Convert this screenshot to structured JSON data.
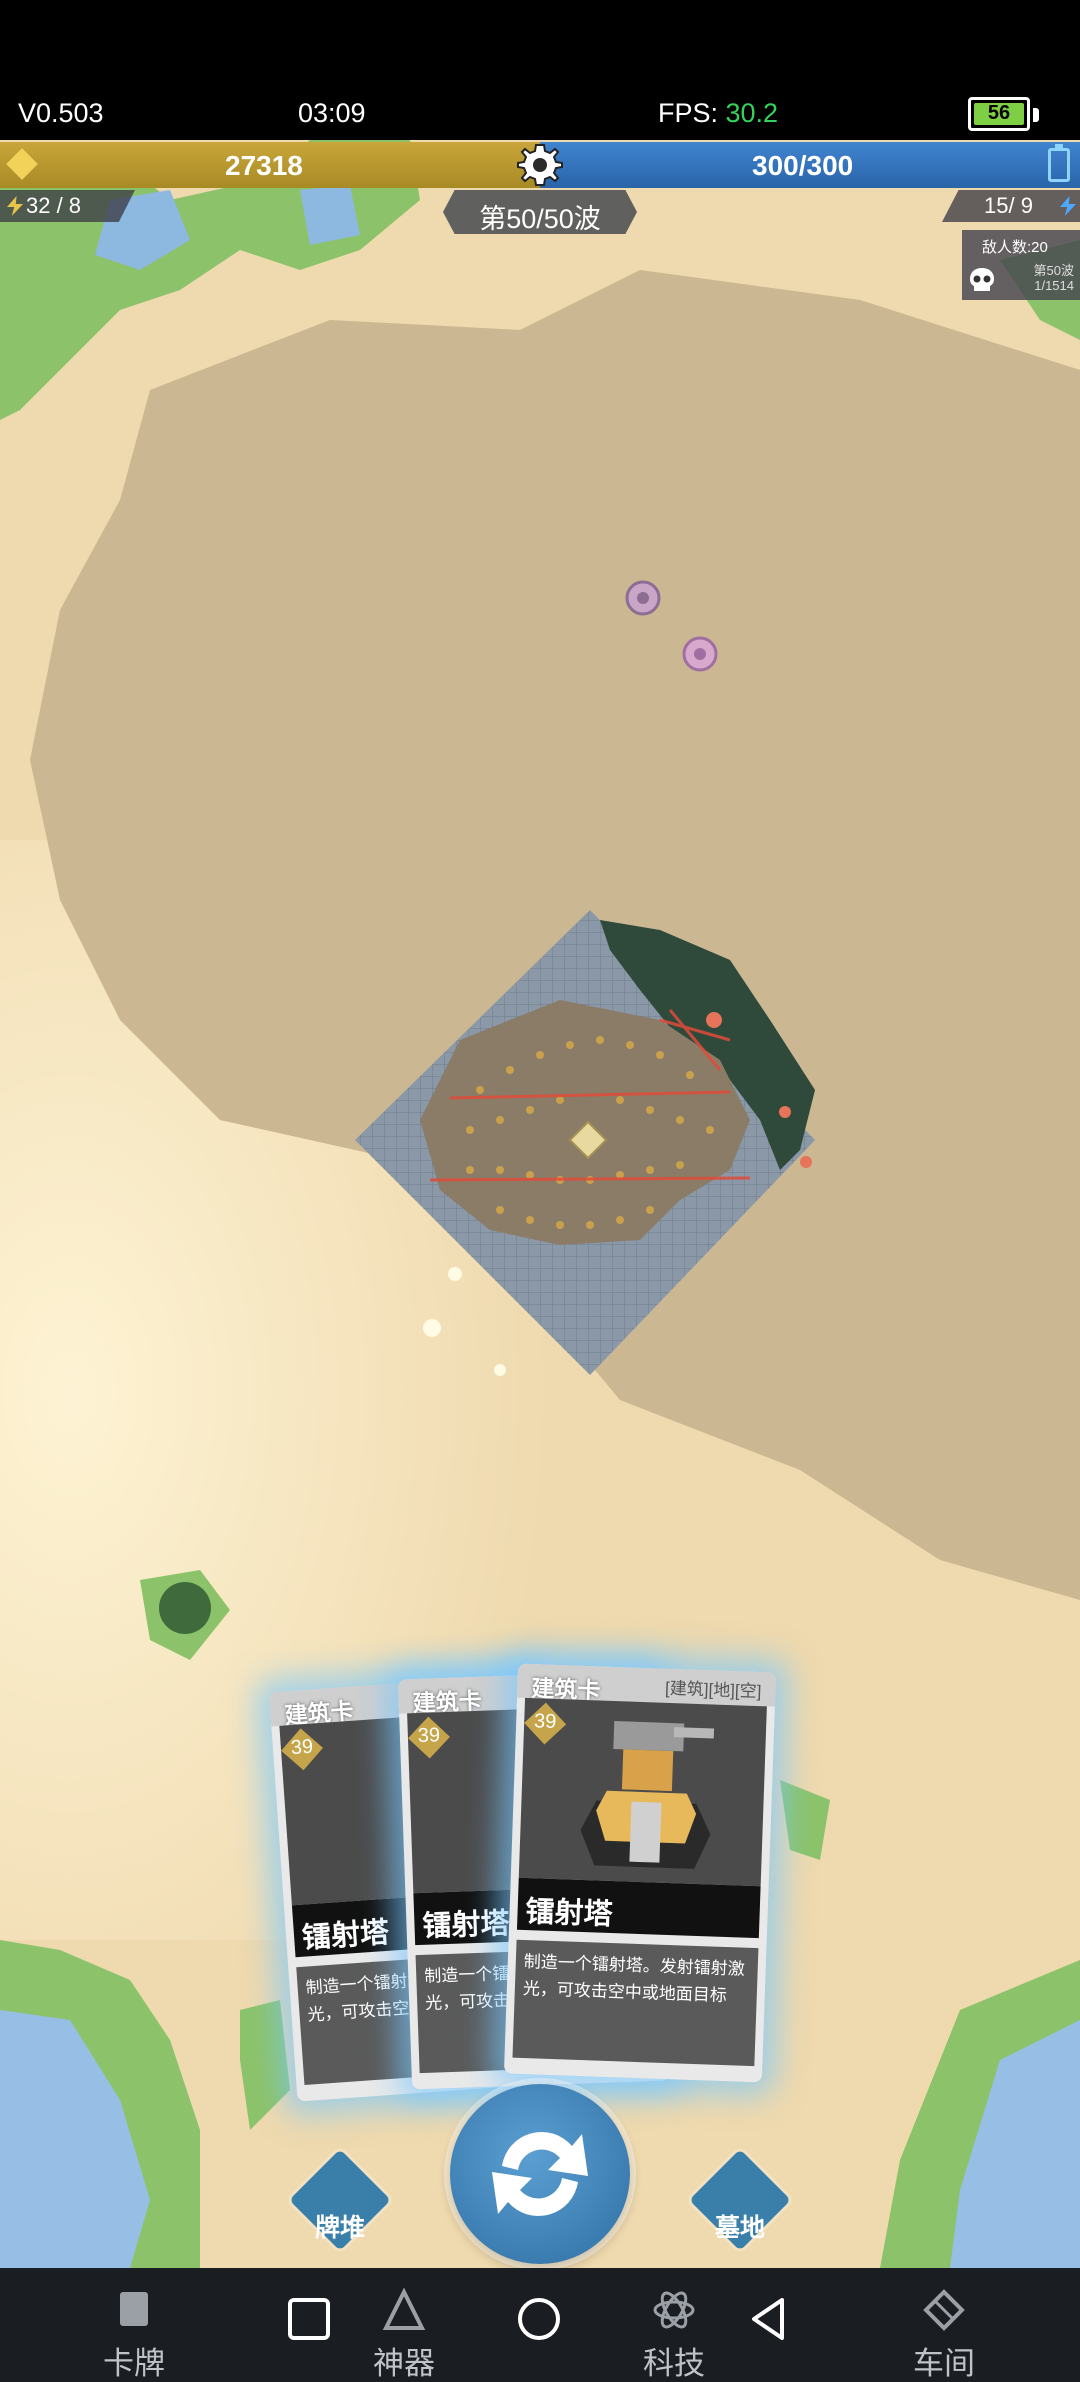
{
  "status_bar": {
    "version": "V0.503",
    "time": "03:09",
    "fps_label": "FPS: ",
    "fps_value": "30.2",
    "battery": "56"
  },
  "hud": {
    "gold": "27318",
    "energy": "300/300",
    "capacity_left": "32 / 8",
    "capacity_right": "15/  9",
    "wave": "第50/50波",
    "enemy_count": "敌人数:20",
    "enemy_wave": "第50波",
    "enemy_progress": "1/1514"
  },
  "cards": [
    {
      "type": "建筑卡",
      "cost": "39",
      "name": "镭射塔",
      "desc": "制造一个镭射塔。发射镭射激光，可攻击空中或地面目标",
      "tags": ""
    },
    {
      "type": "建筑卡",
      "cost": "39",
      "name": "镭射塔",
      "desc": "制造一个镭射塔。发射镭射激光，可攻击空中或地面目标",
      "tags": ""
    },
    {
      "type": "建筑卡",
      "cost": "39",
      "name": "镭射塔",
      "desc": "制造一个镭射塔。发射镭射激光，可攻击空中或地面目标",
      "tags": "[建筑][地][空]"
    }
  ],
  "actions": {
    "deck": "牌堆",
    "graveyard": "墓地"
  },
  "nav": {
    "cards": "卡牌",
    "artifact": "神器",
    "tech": "科技",
    "workshop": "车间"
  },
  "colors": {
    "gold_bar": "#b8982f",
    "energy_bar": "#3574bd",
    "fps_value": "#36d15b",
    "card_glow": "#78c8ff",
    "sand": "#efd9ae"
  }
}
